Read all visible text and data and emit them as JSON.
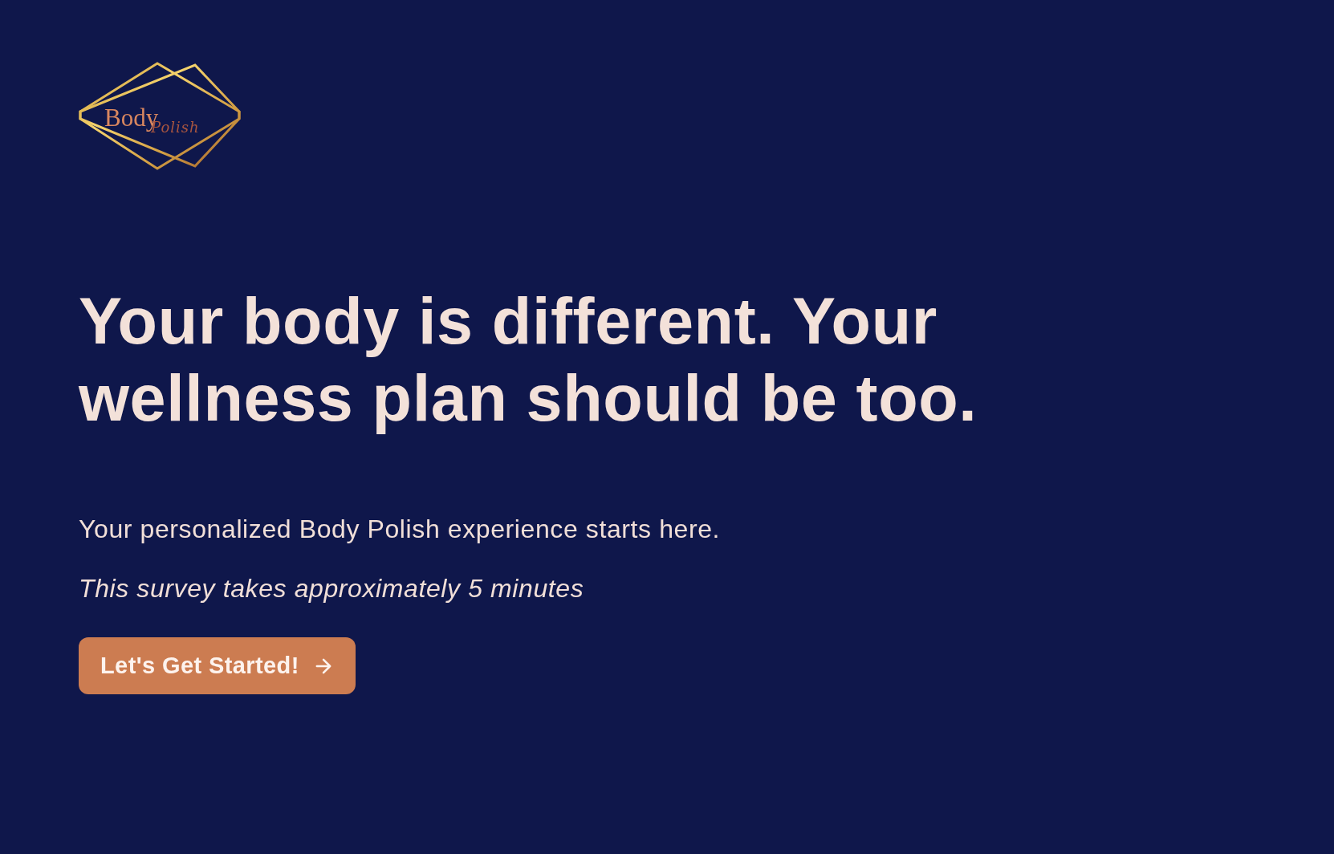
{
  "logo": {
    "wordmark": "Body",
    "script": "Polish"
  },
  "headline": "Your body is different. Your wellness plan should be too.",
  "intro": "Your personalized Body Polish experience starts here.",
  "duration_note": "This survey takes approximately 5 minutes",
  "start_button": {
    "label": "Let's Get Started!"
  }
}
